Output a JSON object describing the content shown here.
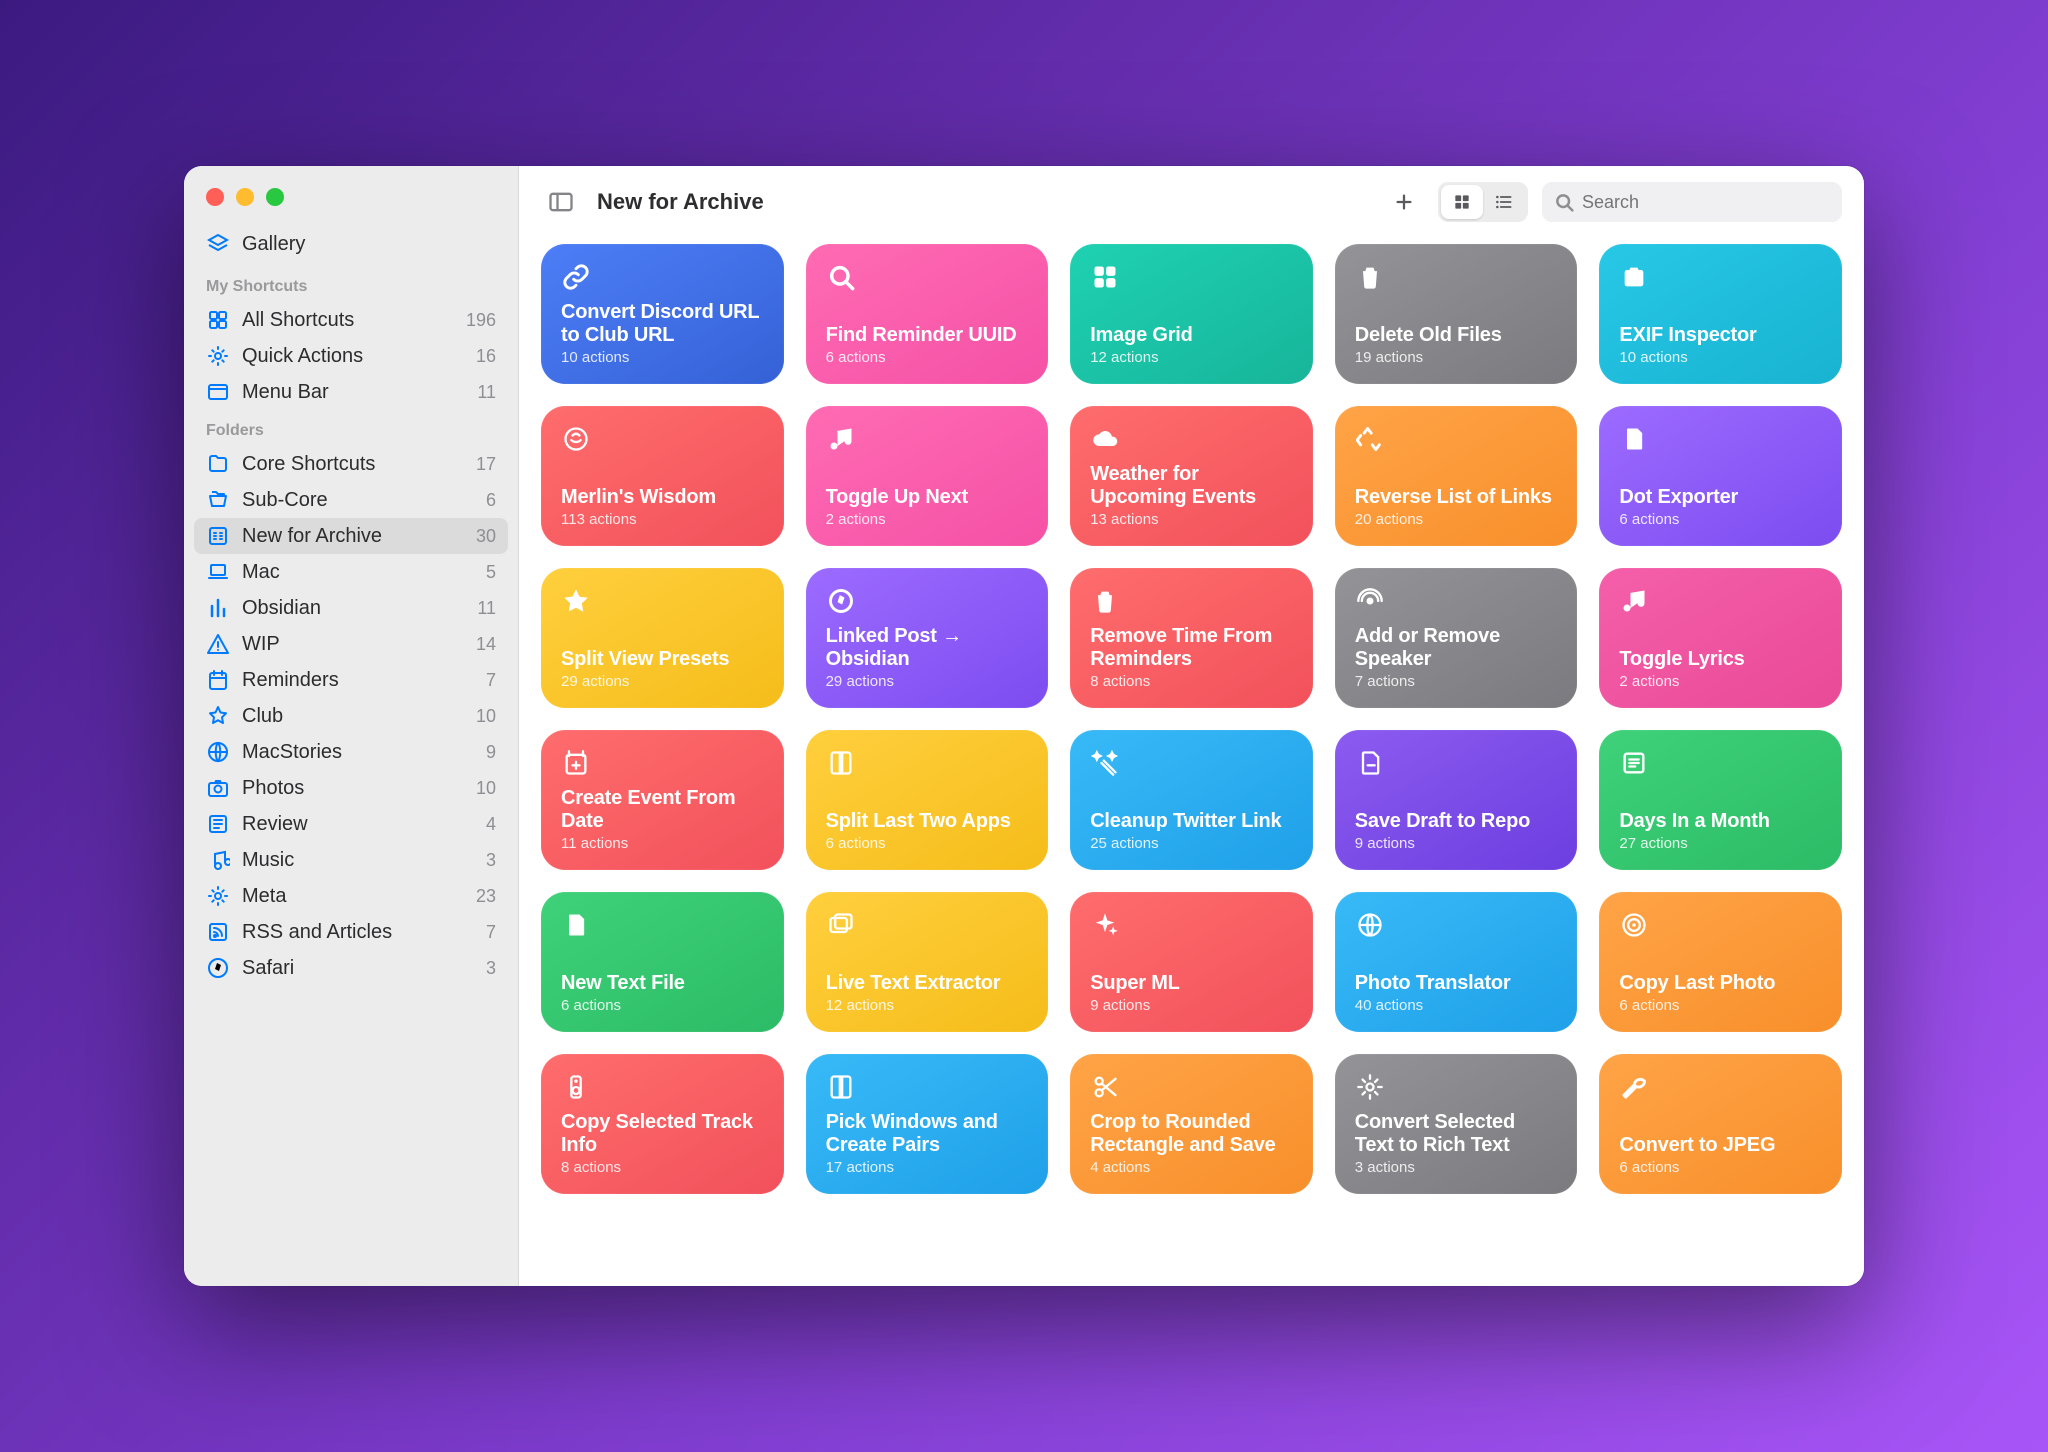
{
  "header": {
    "title": "New for Archive",
    "search_placeholder": "Search"
  },
  "sidebar": {
    "gallery_label": "Gallery",
    "section_my_shortcuts": "My Shortcuts",
    "section_folders": "Folders",
    "my_shortcuts": [
      {
        "label": "All Shortcuts",
        "count": "196",
        "icon": "grid"
      },
      {
        "label": "Quick Actions",
        "count": "16",
        "icon": "gear"
      },
      {
        "label": "Menu Bar",
        "count": "11",
        "icon": "menubar"
      }
    ],
    "folders": [
      {
        "label": "Core Shortcuts",
        "count": "17",
        "icon": "folder"
      },
      {
        "label": "Sub-Core",
        "count": "6",
        "icon": "folderopen"
      },
      {
        "label": "New for Archive",
        "count": "30",
        "icon": "archive",
        "active": true
      },
      {
        "label": "Mac",
        "count": "5",
        "icon": "laptop"
      },
      {
        "label": "Obsidian",
        "count": "11",
        "icon": "bars"
      },
      {
        "label": "WIP",
        "count": "14",
        "icon": "warning"
      },
      {
        "label": "Reminders",
        "count": "7",
        "icon": "calendar"
      },
      {
        "label": "Club",
        "count": "10",
        "icon": "star"
      },
      {
        "label": "MacStories",
        "count": "9",
        "icon": "globe"
      },
      {
        "label": "Photos",
        "count": "10",
        "icon": "camera"
      },
      {
        "label": "Review",
        "count": "4",
        "icon": "news"
      },
      {
        "label": "Music",
        "count": "3",
        "icon": "music"
      },
      {
        "label": "Meta",
        "count": "23",
        "icon": "gear"
      },
      {
        "label": "RSS and Articles",
        "count": "7",
        "icon": "rss"
      },
      {
        "label": "Safari",
        "count": "3",
        "icon": "compass"
      }
    ]
  },
  "cards": [
    {
      "title": "Convert Discord URL to Club URL",
      "sub": "10 actions",
      "color": "blue",
      "icon": "link"
    },
    {
      "title": "Find Reminder UUID",
      "sub": "6 actions",
      "color": "pink",
      "icon": "search"
    },
    {
      "title": "Image Grid",
      "sub": "12 actions",
      "color": "teal",
      "icon": "grid4"
    },
    {
      "title": "Delete Old Files",
      "sub": "19 actions",
      "color": "grey",
      "icon": "trash"
    },
    {
      "title": "EXIF Inspector",
      "sub": "10 actions",
      "color": "cyan",
      "icon": "camera"
    },
    {
      "title": "Merlin's Wisdom",
      "sub": "113 actions",
      "color": "red",
      "icon": "brain"
    },
    {
      "title": "Toggle Up Next",
      "sub": "2 actions",
      "color": "pink",
      "icon": "music"
    },
    {
      "title": "Weather for Upcoming Events",
      "sub": "13 actions",
      "color": "red",
      "icon": "cloud"
    },
    {
      "title": "Reverse List of Links",
      "sub": "20 actions",
      "color": "orange",
      "icon": "recycle"
    },
    {
      "title": "Dot Exporter",
      "sub": "6 actions",
      "color": "purple",
      "icon": "doc"
    },
    {
      "title": "Split View Presets",
      "sub": "29 actions",
      "color": "yellow",
      "icon": "star"
    },
    {
      "title": "Linked Post → Obsidian",
      "sub": "29 actions",
      "color": "purple",
      "icon": "compass"
    },
    {
      "title": "Remove Time From Reminders",
      "sub": "8 actions",
      "color": "red",
      "icon": "trash"
    },
    {
      "title": "Add or Remove Speaker",
      "sub": "7 actions",
      "color": "grey",
      "icon": "broadcast"
    },
    {
      "title": "Toggle Lyrics",
      "sub": "2 actions",
      "color": "darkpink",
      "icon": "music"
    },
    {
      "title": "Create Event From Date",
      "sub": "11 actions",
      "color": "red",
      "icon": "calplus"
    },
    {
      "title": "Split Last Two Apps",
      "sub": "6 actions",
      "color": "yellow",
      "icon": "book"
    },
    {
      "title": "Cleanup Twitter Link",
      "sub": "25 actions",
      "color": "skyblue",
      "icon": "wand"
    },
    {
      "title": "Save Draft to Repo",
      "sub": "9 actions",
      "color": "darkpurple",
      "icon": "docminus"
    },
    {
      "title": "Days In a Month",
      "sub": "27 actions",
      "color": "green",
      "icon": "lines"
    },
    {
      "title": "New Text File",
      "sub": "6 actions",
      "color": "green",
      "icon": "doc"
    },
    {
      "title": "Live Text Extractor",
      "sub": "12 actions",
      "color": "yellow",
      "icon": "photos"
    },
    {
      "title": "Super ML",
      "sub": "9 actions",
      "color": "red",
      "icon": "sparkle"
    },
    {
      "title": "Photo Translator",
      "sub": "40 actions",
      "color": "skyblue",
      "icon": "globe"
    },
    {
      "title": "Copy Last Photo",
      "sub": "6 actions",
      "color": "orange",
      "icon": "target"
    },
    {
      "title": "Copy Selected Track Info",
      "sub": "8 actions",
      "color": "red",
      "icon": "speaker"
    },
    {
      "title": "Pick Windows and Create Pairs",
      "sub": "17 actions",
      "color": "skyblue",
      "icon": "book"
    },
    {
      "title": "Crop to Rounded Rectangle and Save",
      "sub": "4 actions",
      "color": "orange",
      "icon": "scissors"
    },
    {
      "title": "Convert Selected Text to Rich Text",
      "sub": "3 actions",
      "color": "grey",
      "icon": "gear"
    },
    {
      "title": "Convert to JPEG",
      "sub": "6 actions",
      "color": "orange",
      "icon": "wrench"
    }
  ]
}
